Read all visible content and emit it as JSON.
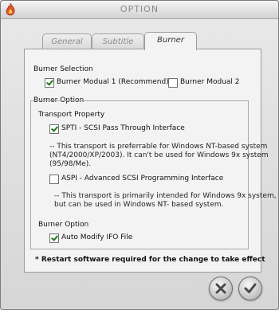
{
  "window": {
    "title": "OPTION"
  },
  "tabs": [
    {
      "label": "General",
      "active": false
    },
    {
      "label": "Subtitle",
      "active": false
    },
    {
      "label": "Burner",
      "active": true
    }
  ],
  "burner_selection": {
    "heading": "Burner Selection",
    "modual1": {
      "label": "Burner Modual 1 (Recommend)",
      "checked": true
    },
    "modual2": {
      "label": "Burner Modual 2",
      "checked": false
    }
  },
  "burner_option": {
    "group_label": "Burner Option",
    "transport_heading": "Transport Property",
    "spti": {
      "label": "SPTI - SCSI Pass Through Interface",
      "checked": true
    },
    "spti_note_1": "-- This transport is preferrable for Windows NT-based system",
    "spti_note_2": "(NT4/2000/XP/2003). It can't be used for Windows 9x system",
    "spti_note_3": "(95/98/Me).",
    "aspi": {
      "label": "ASPI - Advanced SCSI Programming Interface",
      "checked": false
    },
    "aspi_note_1": "-- This transport is primarily intended for Windows 9x system,",
    "aspi_note_2": "but can be used in Windows NT- based system.",
    "sub_heading": "Burner Option",
    "auto_modify": {
      "label": "Auto Modify IFO File",
      "checked": true
    }
  },
  "restart_notice": "* Restart software required for the change to take effect",
  "colors": {
    "check_mark": "#1d7a1d",
    "cancel_x": "#4a4a4a"
  }
}
